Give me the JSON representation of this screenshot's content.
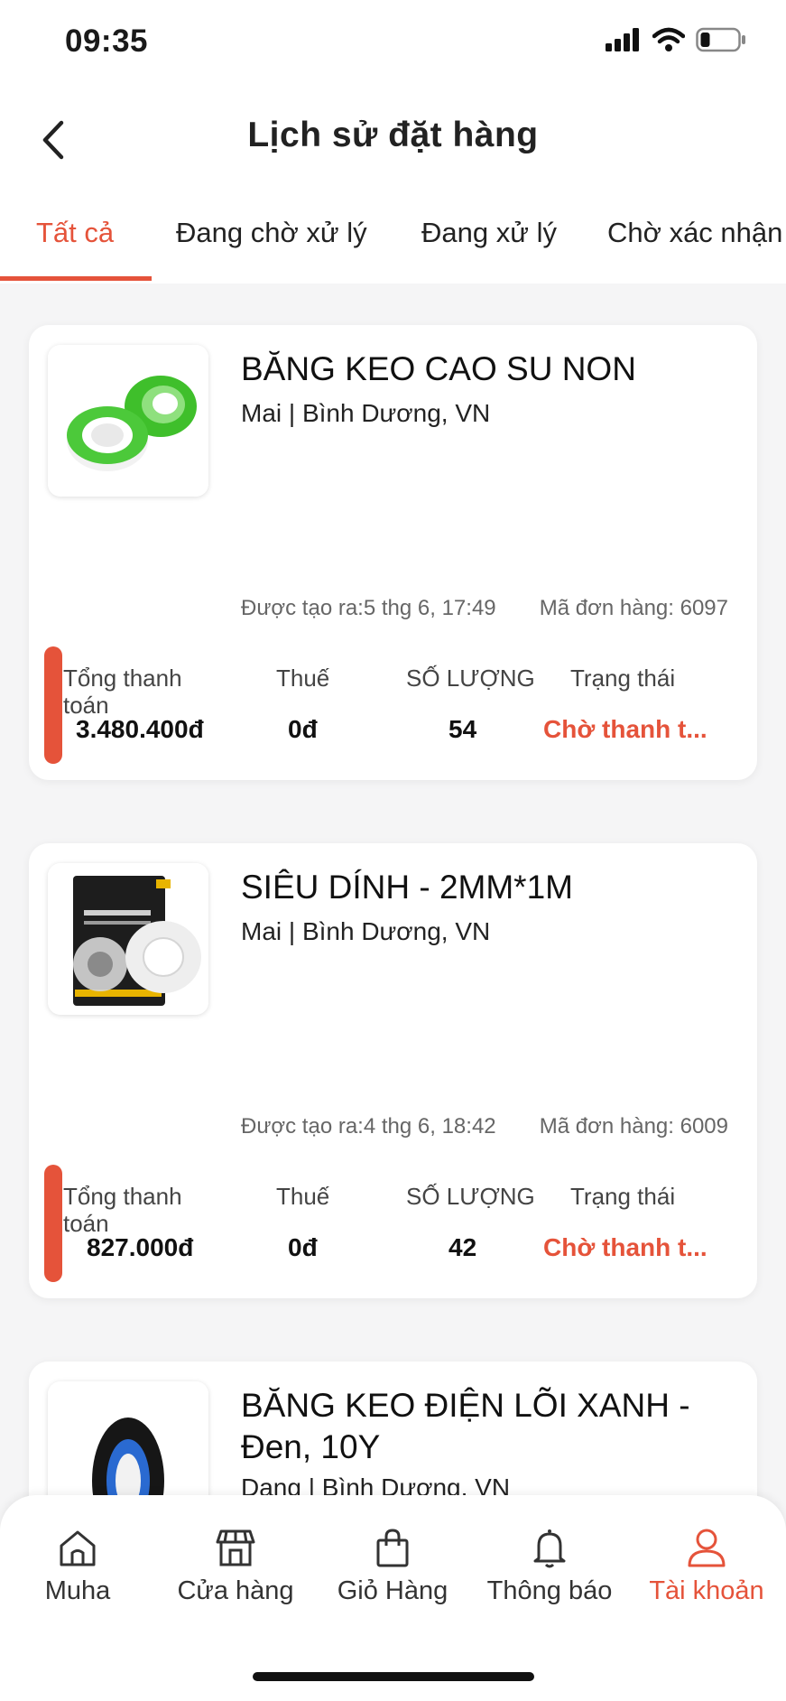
{
  "status_bar": {
    "time": "09:35"
  },
  "header": {
    "title": "Lịch sử đặt hàng"
  },
  "tabs": [
    {
      "label": "Tất cả",
      "active": true
    },
    {
      "label": "Đang chờ xử lý"
    },
    {
      "label": "Đang xử lý"
    },
    {
      "label": "Chờ xác nhận"
    }
  ],
  "columns": {
    "total": "Tổng thanh toán",
    "tax": "Thuế",
    "qty": "SỐ LƯỢNG",
    "status": "Trạng thái"
  },
  "orders": [
    {
      "name": "BĂNG KEO CAO SU NON",
      "location": "Mai | Bình Dương, VN",
      "created": "Được tạo ra:5 thg 6, 17:49",
      "order_no": "Mã đơn hàng: 6097",
      "total": "3.480.400đ",
      "tax": "0đ",
      "qty": "54",
      "status": "Chờ thanh t..."
    },
    {
      "name": "SIÊU DÍNH - 2MM*1M",
      "location": "Mai | Bình Dương, VN",
      "created": "Được tạo ra:4 thg 6, 18:42",
      "order_no": "Mã đơn hàng: 6009",
      "total": "827.000đ",
      "tax": "0đ",
      "qty": "42",
      "status": "Chờ thanh t..."
    },
    {
      "name": "BĂNG KEO ĐIỆN LÕI XANH - Đen, 10Y",
      "location": "Dang | Bình Dương, VN"
    }
  ],
  "bottom_nav": [
    {
      "label": "Muha",
      "icon": "home-icon"
    },
    {
      "label": "Cửa hàng",
      "icon": "store-icon"
    },
    {
      "label": "Giỏ Hàng",
      "icon": "bag-icon"
    },
    {
      "label": "Thông báo",
      "icon": "bell-icon"
    },
    {
      "label": "Tài khoản",
      "icon": "user-icon",
      "active": true
    }
  ],
  "colors": {
    "accent": "#e5533a",
    "background": "#f5f5f6"
  }
}
